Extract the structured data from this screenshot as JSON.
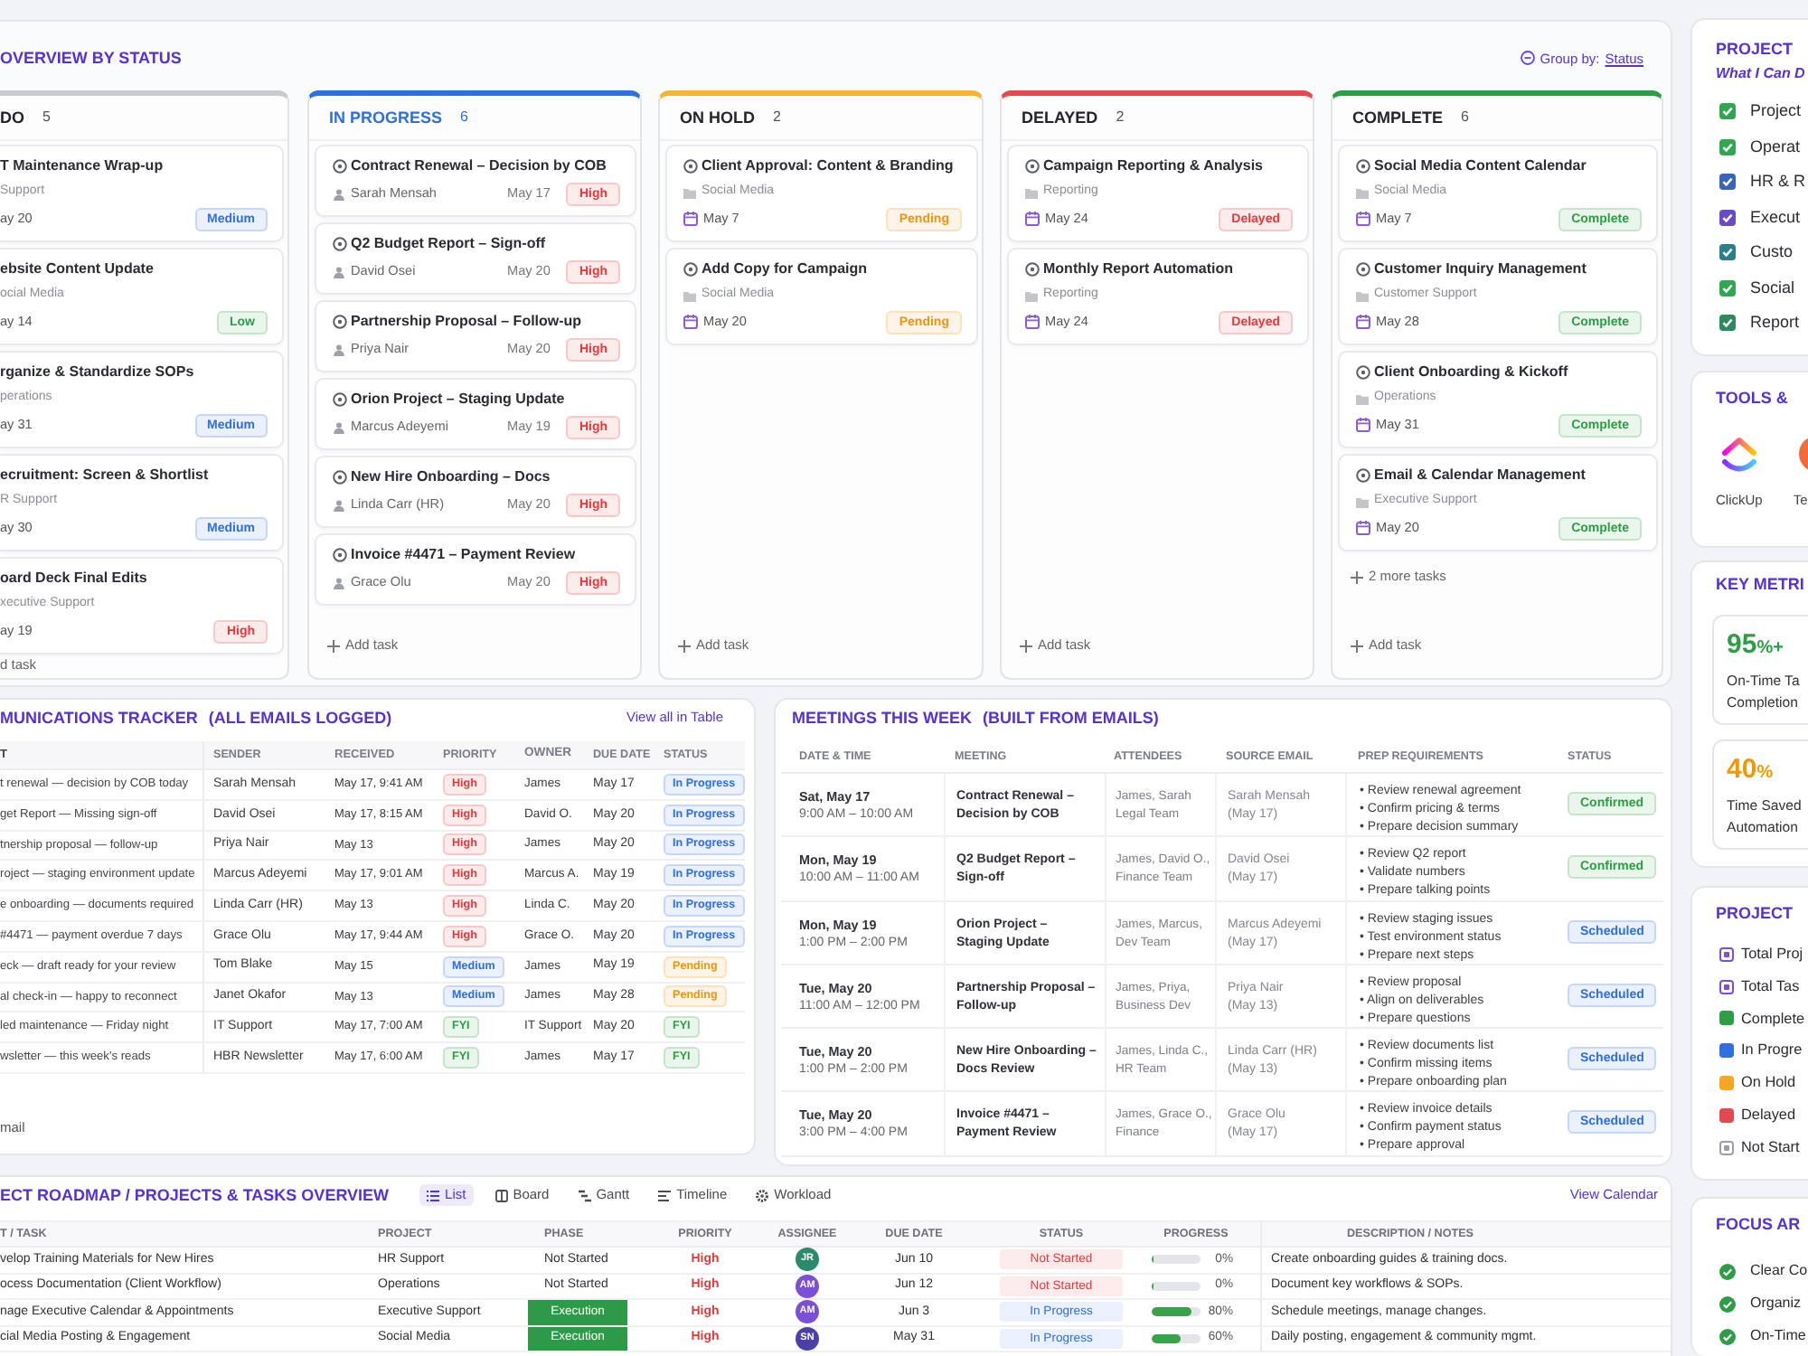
{
  "board": {
    "title": "OVERVIEW BY STATUS",
    "group_by": {
      "label": "Group by:",
      "value": "Status"
    },
    "columns": [
      {
        "title": "DO",
        "count": "5",
        "color": "#c9cacf",
        "highlighted": false,
        "icons": false,
        "cards": [
          {
            "title": "T Maintenance Wrap-up",
            "category": "Support",
            "date": "ay 20",
            "badge": {
              "text": "Medium",
              "color": "#2f6fe0"
            }
          },
          {
            "title": "ebsite Content Update",
            "category": "ocial Media",
            "date": "ay 14",
            "badge": {
              "text": "Low",
              "color": "#2e9e46"
            }
          },
          {
            "title": "rganize & Standardize SOPs",
            "category": "perations",
            "date": "ay 31",
            "badge": {
              "text": "Medium",
              "color": "#2f6fe0"
            }
          },
          {
            "title": "ecruitment: Screen & Shortlist",
            "category": "R Support",
            "date": "ay 30",
            "badge": {
              "text": "Medium",
              "color": "#2f6fe0"
            }
          },
          {
            "title": "oard Deck Final Edits",
            "category": "xecutive Support",
            "date": "ay 19",
            "badge": {
              "text": "High",
              "color": "#e5393b"
            }
          }
        ],
        "add_task": "d task"
      },
      {
        "title": "IN PROGRESS",
        "count": "6",
        "color": "#2f6fe0",
        "highlighted": true,
        "icons": true,
        "cards": [
          {
            "title": "Contract Renewal – Decision by COB",
            "person": "Sarah Mensah",
            "date": "May 17",
            "badge": {
              "text": "High",
              "color": "#e5393b"
            }
          },
          {
            "title": "Q2 Budget Report – Sign-off",
            "person": "David Osei",
            "date": "May 20",
            "badge": {
              "text": "High",
              "color": "#e5393b"
            }
          },
          {
            "title": "Partnership Proposal – Follow-up",
            "person": "Priya Nair",
            "date": "May 20",
            "badge": {
              "text": "High",
              "color": "#e5393b"
            }
          },
          {
            "title": "Orion Project – Staging Update",
            "person": "Marcus Adeyemi",
            "date": "May 19",
            "badge": {
              "text": "High",
              "color": "#e5393b"
            }
          },
          {
            "title": "New Hire Onboarding – Docs",
            "person": "Linda Carr (HR)",
            "date": "May 20",
            "badge": {
              "text": "High",
              "color": "#e5393b"
            }
          },
          {
            "title": "Invoice #4471 – Payment Review",
            "person": "Grace Olu",
            "date": "May 20",
            "badge": {
              "text": "High",
              "color": "#e5393b"
            }
          }
        ],
        "add_task": "Add task"
      },
      {
        "title": "ON HOLD",
        "count": "2",
        "color": "#f5b52e",
        "highlighted": false,
        "icons": true,
        "cards": [
          {
            "title": "Client Approval: Content & Branding",
            "category": "Social Media",
            "date": "May 7",
            "badge": {
              "text": "Pending",
              "color": "#f0940f"
            }
          },
          {
            "title": "Add Copy for Campaign",
            "category": "Social Media",
            "date": "May 20",
            "badge": {
              "text": "Pending",
              "color": "#f0940f"
            }
          }
        ],
        "add_task": "Add task"
      },
      {
        "title": "DELAYED",
        "count": "2",
        "color": "#e5484d",
        "highlighted": false,
        "icons": true,
        "cards": [
          {
            "title": "Campaign Reporting & Analysis",
            "category": "Reporting",
            "date": "May 24",
            "badge": {
              "text": "Delayed",
              "color": "#e5393b"
            }
          },
          {
            "title": "Monthly Report Automation",
            "category": "Reporting",
            "date": "May 24",
            "badge": {
              "text": "Delayed",
              "color": "#e5393b"
            }
          }
        ],
        "add_task": "Add task"
      },
      {
        "title": "COMPLETE",
        "count": "6",
        "color": "#2e9e46",
        "highlighted": false,
        "icons": true,
        "cards": [
          {
            "title": "Social Media Content Calendar",
            "category": "Social Media",
            "date": "May 7",
            "badge": {
              "text": "Complete",
              "color": "#2e9e46"
            }
          },
          {
            "title": "Customer Inquiry Management",
            "category": "Customer Support",
            "date": "May 28",
            "badge": {
              "text": "Complete",
              "color": "#2e9e46"
            }
          },
          {
            "title": "Client Onboarding & Kickoff",
            "category": "Operations",
            "date": "May 31",
            "badge": {
              "text": "Complete",
              "color": "#2e9e46"
            }
          },
          {
            "title": "Email & Calendar Management",
            "category": "Executive Support",
            "date": "May 20",
            "badge": {
              "text": "Complete",
              "color": "#2e9e46"
            }
          }
        ],
        "more": "2 more tasks",
        "add_task": "Add task"
      }
    ]
  },
  "communications": {
    "title": "MUNICATIONS TRACKER",
    "subtitle": "(ALL EMAILS LOGGED)",
    "link": "View all in Table",
    "columns": [
      "T",
      "SENDER",
      "RECEIVED",
      "PRIORITY",
      "OWNER",
      "DUE DATE",
      "STATUS"
    ],
    "rows": [
      {
        "subject": "t renewal — decision by COB today",
        "sender": "Sarah Mensah",
        "received": "May 17, 9:41 AM",
        "priority": {
          "text": "High",
          "color": "#e5393b"
        },
        "owner": "James",
        "due": "May 17",
        "status": {
          "text": "In Progress",
          "color": "#2f6fe0"
        }
      },
      {
        "subject": "get Report — Missing sign-off",
        "sender": "David Osei",
        "received": "May 17, 8:15 AM",
        "priority": {
          "text": "High",
          "color": "#e5393b"
        },
        "owner": "David O.",
        "due": "May 20",
        "status": {
          "text": "In Progress",
          "color": "#2f6fe0"
        }
      },
      {
        "subject": "tnership proposal — follow-up",
        "sender": "Priya Nair",
        "received": "May 13",
        "priority": {
          "text": "High",
          "color": "#e5393b"
        },
        "owner": "James",
        "due": "May 20",
        "status": {
          "text": "In Progress",
          "color": "#2f6fe0"
        }
      },
      {
        "subject": "roject — staging environment update",
        "sender": "Marcus Adeyemi",
        "received": "May 17, 9:01 AM",
        "priority": {
          "text": "High",
          "color": "#e5393b"
        },
        "owner": "Marcus A.",
        "due": "May 19",
        "status": {
          "text": "In Progress",
          "color": "#2f6fe0"
        }
      },
      {
        "subject": "e onboarding — documents required",
        "sender": "Linda Carr (HR)",
        "received": "May 13",
        "priority": {
          "text": "High",
          "color": "#e5393b"
        },
        "owner": "Linda C.",
        "due": "May 20",
        "status": {
          "text": "In Progress",
          "color": "#2f6fe0"
        }
      },
      {
        "subject": "#4471 — payment overdue 7 days",
        "sender": "Grace Olu",
        "received": "May 17, 9:44 AM",
        "priority": {
          "text": "High",
          "color": "#e5393b"
        },
        "owner": "Grace O.",
        "due": "May 20",
        "status": {
          "text": "In Progress",
          "color": "#2f6fe0"
        }
      },
      {
        "subject": "eck — draft ready for your review",
        "sender": "Tom Blake",
        "received": "May 15",
        "priority": {
          "text": "Medium",
          "color": "#2f6fe0"
        },
        "owner": "James",
        "due": "May 19",
        "status": {
          "text": "Pending",
          "color": "#f0940f"
        }
      },
      {
        "subject": "al check-in — happy to reconnect",
        "sender": "Janet Okafor",
        "received": "May 13",
        "priority": {
          "text": "Medium",
          "color": "#2f6fe0"
        },
        "owner": "James",
        "due": "May 28",
        "status": {
          "text": "Pending",
          "color": "#f0940f"
        }
      },
      {
        "subject": "led maintenance — Friday night",
        "sender": "IT Support",
        "received": "May 17, 7:00 AM",
        "priority": {
          "text": "FYI",
          "color": "#2e9e46"
        },
        "owner": "IT Support",
        "due": "May 20",
        "status": {
          "text": "FYI",
          "color": "#2e9e46"
        }
      },
      {
        "subject": "wsletter — this week's reads",
        "sender": "HBR Newsletter",
        "received": "May 17, 6:00 AM",
        "priority": {
          "text": "FYI",
          "color": "#2e9e46"
        },
        "owner": "James",
        "due": "May 17",
        "status": {
          "text": "FYI",
          "color": "#2e9e46"
        }
      }
    ],
    "footer": "mail"
  },
  "meetings": {
    "title": "MEETINGS THIS WEEK",
    "subtitle": "(BUILT FROM EMAILS)",
    "columns": [
      "DATE & TIME",
      "MEETING",
      "ATTENDEES",
      "SOURCE EMAIL",
      "PREP REQUIREMENTS",
      "STATUS"
    ],
    "rows": [
      {
        "date": "Sat, May 17",
        "time": "9:00 AM – 10:00 AM",
        "meeting": "Contract Renewal –\nDecision by COB",
        "attendees": "James, Sarah\nLegal Team",
        "source": "Sarah Mensah\n(May 17)",
        "prep": [
          "• Review renewal agreement",
          "• Confirm pricing & terms",
          "• Prepare decision summary"
        ],
        "status": {
          "text": "Confirmed",
          "color": "#2e9e46"
        }
      },
      {
        "date": "Mon, May 19",
        "time": "10:00 AM – 11:00 AM",
        "meeting": "Q2 Budget Report –\nSign-off",
        "attendees": "James, David O.,\nFinance Team",
        "source": "David Osei\n(May 17)",
        "prep": [
          "• Review Q2 report",
          "• Validate numbers",
          "• Prepare talking points"
        ],
        "status": {
          "text": "Confirmed",
          "color": "#2e9e46"
        }
      },
      {
        "date": "Mon, May 19",
        "time": "1:00 PM – 2:00 PM",
        "meeting": "Orion Project –\nStaging Update",
        "attendees": "James, Marcus,\nDev Team",
        "source": "Marcus Adeyemi\n(May 17)",
        "prep": [
          "• Review staging issues",
          "• Test environment status",
          "• Prepare next steps"
        ],
        "status": {
          "text": "Scheduled",
          "color": "#2f6fe0"
        }
      },
      {
        "date": "Tue, May 20",
        "time": "11:00 AM – 12:00 PM",
        "meeting": "Partnership Proposal –\nFollow-up",
        "attendees": "James, Priya,\nBusiness Dev",
        "source": "Priya Nair\n(May 13)",
        "prep": [
          "• Review proposal",
          "• Align on deliverables",
          "• Prepare questions"
        ],
        "status": {
          "text": "Scheduled",
          "color": "#2f6fe0"
        }
      },
      {
        "date": "Tue, May 20",
        "time": "1:00 PM – 2:00 PM",
        "meeting": "New Hire Onboarding –\nDocs Review",
        "attendees": "James, Linda C.,\nHR Team",
        "source": "Linda Carr (HR)\n(May 13)",
        "prep": [
          "• Review documents list",
          "• Confirm missing items",
          "• Prepare onboarding plan"
        ],
        "status": {
          "text": "Scheduled",
          "color": "#2f6fe0"
        }
      },
      {
        "date": "Tue, May 20",
        "time": "3:00 PM – 4:00 PM",
        "meeting": "Invoice #4471 –\nPayment Review",
        "attendees": "James, Grace O.,\nFinance",
        "source": "Grace Olu\n(May 17)",
        "prep": [
          "• Review invoice details",
          "• Confirm payment status",
          "• Prepare approval"
        ],
        "status": {
          "text": "Scheduled",
          "color": "#2f6fe0"
        }
      }
    ]
  },
  "roadmap": {
    "title": "ECT ROADMAP / PROJECTS & TASKS OVERVIEW",
    "tabs": [
      {
        "label": "List",
        "selected": true
      },
      {
        "label": "Board",
        "selected": false
      },
      {
        "label": "Gantt",
        "selected": false
      },
      {
        "label": "Timeline",
        "selected": false
      },
      {
        "label": "Workload",
        "selected": false
      }
    ],
    "link": "View Calendar",
    "columns": [
      "T / TASK",
      "PROJECT",
      "PHASE",
      "PRIORITY",
      "ASSIGNEE",
      "DUE DATE",
      "STATUS",
      "PROGRESS",
      "DESCRIPTION / NOTES"
    ],
    "rows": [
      {
        "task": "velop Training Materials for New Hires",
        "project": "HR Support",
        "phase": {
          "text": "Not Started"
        },
        "priority": "High",
        "assignee": {
          "initials": "JR",
          "color": "#2b8a6b"
        },
        "due": "Jun 10",
        "status": {
          "text": "Not Started",
          "color": "#e5393b"
        },
        "level": 0,
        "reading": "0%",
        "notes": "Create onboarding guides & training docs."
      },
      {
        "task": "ocess Documentation (Client Workflow)",
        "project": "Operations",
        "phase": {
          "text": "Not Started"
        },
        "priority": "High",
        "assignee": {
          "initials": "AM",
          "color": "#7b4fd6"
        },
        "due": "Jun 12",
        "status": {
          "text": "Not Started",
          "color": "#e5393b"
        },
        "level": 0,
        "reading": "0%",
        "notes": "Document key workflows & SOPs."
      },
      {
        "task": "nage Executive Calendar & Appointments",
        "project": "Executive Support",
        "phase": {
          "text": "Execution",
          "color": "#2c9a46"
        },
        "priority": "High",
        "assignee": {
          "initials": "AM",
          "color": "#7b4fd6"
        },
        "due": "Jun 3",
        "status": {
          "text": "In Progress",
          "color": "#2f6fe0"
        },
        "level": 0.8,
        "reading": "80%",
        "notes": "Schedule meetings, manage changes."
      },
      {
        "task": "cial Media Posting & Engagement",
        "project": "Social Media",
        "phase": {
          "text": "Execution",
          "color": "#2c9a46"
        },
        "priority": "High",
        "assignee": {
          "initials": "SN",
          "color": "#4b3fa8"
        },
        "due": "May 31",
        "status": {
          "text": "In Progress",
          "color": "#2f6fe0"
        },
        "level": 0.6,
        "reading": "60%",
        "notes": "Daily posting, engagement & community mgmt."
      }
    ]
  },
  "sidebar": {
    "capabilities": {
      "title": "PROJECT",
      "subtitle": "What I Can D",
      "items": [
        {
          "label": "Project",
          "checked": true,
          "color": "#2fa84f"
        },
        {
          "label": "Operat",
          "checked": true,
          "color": "#2fa84f"
        },
        {
          "label": "HR & R",
          "checked": true,
          "color": "#3a66b8"
        },
        {
          "label": "Execut",
          "checked": true,
          "color": "#6b4bc4"
        },
        {
          "label": "Custo",
          "checked": true,
          "color": "#2b7f8c"
        },
        {
          "label": "Social",
          "checked": true,
          "color": "#2fa84f"
        },
        {
          "label": "Report",
          "checked": true,
          "color": "#2b8a5e"
        }
      ]
    },
    "tools": {
      "title": "TOOLS &",
      "items": [
        {
          "label": "ClickUp",
          "kind": "chevrons"
        },
        {
          "label": "Te",
          "kind": "disc"
        }
      ]
    },
    "metrics": {
      "title": "KEY METRI",
      "cards": [
        {
          "value": "95",
          "unit": "%+",
          "label": "On-Time Ta\nCompletion",
          "color": "#2e9e46"
        },
        {
          "value": "40",
          "unit": "%",
          "label": "Time Saved\nAutomation",
          "color": "#f29900"
        }
      ]
    },
    "status": {
      "title": "PROJECT",
      "items": [
        {
          "label": "Total Proj",
          "kind": "outline",
          "color": "#7b4fd6"
        },
        {
          "label": "Total Tas",
          "kind": "outline",
          "color": "#7b4fd6"
        },
        {
          "label": "Complete",
          "kind": "solid",
          "color": "#2e9e46"
        },
        {
          "label": "In Progre",
          "kind": "solid",
          "color": "#2f6fe0"
        },
        {
          "label": "On Hold",
          "kind": "solid",
          "color": "#f5a623"
        },
        {
          "label": "Delayed",
          "kind": "solid",
          "color": "#e5484d"
        },
        {
          "label": "Not Start",
          "kind": "outline",
          "color": "#9a9ea8"
        }
      ]
    },
    "focus": {
      "title": "FOCUS AR",
      "items": [
        {
          "label": "Clear Co",
          "checked": true
        },
        {
          "label": "Organiz",
          "checked": true
        },
        {
          "label": "On-Time",
          "checked": true
        }
      ]
    }
  }
}
